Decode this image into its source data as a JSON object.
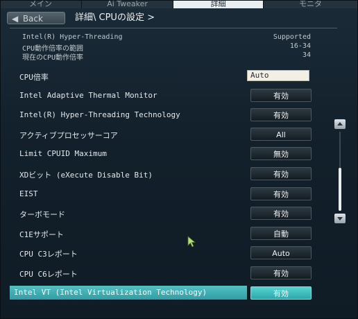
{
  "tabs": [
    {
      "label": "メイン",
      "active": false
    },
    {
      "label": "Ai Tweaker",
      "active": false
    },
    {
      "label": "詳細",
      "active": true
    },
    {
      "label": "モニタ",
      "active": false
    }
  ],
  "nav": {
    "back_label": "Back",
    "breadcrumb": "詳細\\ CPUの設定 >"
  },
  "info": [
    {
      "label": "Intel(R) Hyper-Threading",
      "value": "Supported"
    },
    {
      "label": "CPU動作倍率の範囲",
      "value": "16-34"
    },
    {
      "label": "現在のCPU動作倍率",
      "value": "34"
    }
  ],
  "ratio": {
    "label": "CPU倍率",
    "value": "Auto"
  },
  "settings": [
    {
      "label": "Intel Adaptive Thermal Monitor",
      "value": "有効"
    },
    {
      "label": "Intel(R) Hyper-Threading Technology",
      "value": "有効"
    },
    {
      "label": "アクティブプロセッサーコア",
      "value": "All"
    },
    {
      "label": "Limit CPUID Maximum",
      "value": "無効"
    },
    {
      "label": "XDビット (eXecute Disable Bit)",
      "value": "有効"
    },
    {
      "label": "EIST",
      "value": "有効"
    },
    {
      "label": "ターボモード",
      "value": "有効"
    },
    {
      "label": "C1Eサポート",
      "value": "自動"
    },
    {
      "label": "CPU C3レポート",
      "value": "Auto"
    },
    {
      "label": "CPU C6レポート",
      "value": "有効"
    }
  ],
  "selected": {
    "label": "Intel VT (Intel Virtualization Technology)",
    "value": "有効"
  },
  "colors": {
    "accent": "#3fb3b8",
    "background": "#13212c"
  },
  "icons": {
    "back": "back-arrow-icon",
    "scroll_up": "scroll-up-icon",
    "scroll_down": "scroll-down-icon",
    "cursor": "mouse-pointer-icon"
  }
}
